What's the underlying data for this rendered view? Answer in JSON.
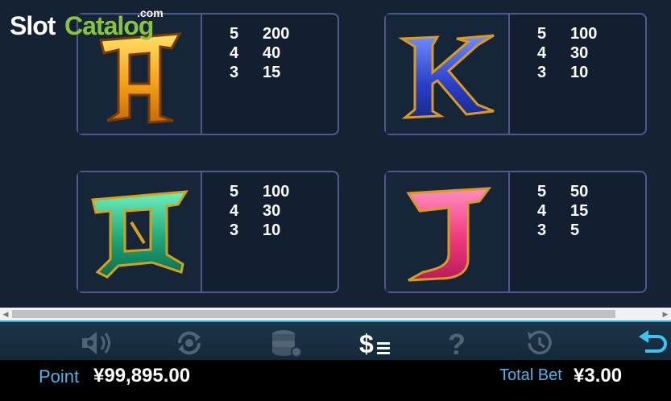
{
  "watermark": {
    "part1": "Slot",
    "part2": "Catalog",
    "suffix": ".com"
  },
  "paytable": {
    "symbols": [
      {
        "symbol": "A",
        "color": "#f2a51f",
        "payouts": [
          {
            "count": "5",
            "value": "200"
          },
          {
            "count": "4",
            "value": "40"
          },
          {
            "count": "3",
            "value": "15"
          }
        ]
      },
      {
        "symbol": "K",
        "color": "#2f4fd4",
        "payouts": [
          {
            "count": "5",
            "value": "100"
          },
          {
            "count": "4",
            "value": "30"
          },
          {
            "count": "3",
            "value": "10"
          }
        ]
      },
      {
        "symbol": "Q",
        "color": "#22b884",
        "payouts": [
          {
            "count": "5",
            "value": "100"
          },
          {
            "count": "4",
            "value": "30"
          },
          {
            "count": "3",
            "value": "10"
          }
        ]
      },
      {
        "symbol": "J",
        "color": "#f03f86",
        "payouts": [
          {
            "count": "5",
            "value": "50"
          },
          {
            "count": "4",
            "value": "15"
          },
          {
            "count": "3",
            "value": "5"
          }
        ]
      }
    ]
  },
  "toolbar": {
    "buttons": [
      {
        "name": "sound",
        "icon": "speaker-gear-icon"
      },
      {
        "name": "autoplay",
        "icon": "autoplay-cycle-icon"
      },
      {
        "name": "chips",
        "icon": "chip-stack-icon"
      },
      {
        "name": "paytable",
        "icon": "dollar-lines-icon",
        "active": true
      },
      {
        "name": "help",
        "icon": "question-mark-icon"
      },
      {
        "name": "history",
        "icon": "history-clock-icon"
      },
      {
        "name": "back",
        "icon": "return-arrow-icon"
      }
    ],
    "accent_color": "#28b3d8"
  },
  "status": {
    "point_label": "Point",
    "point_value": "¥99,895.00",
    "total_bet_label": "Total Bet",
    "total_bet_value": "¥3.00"
  }
}
